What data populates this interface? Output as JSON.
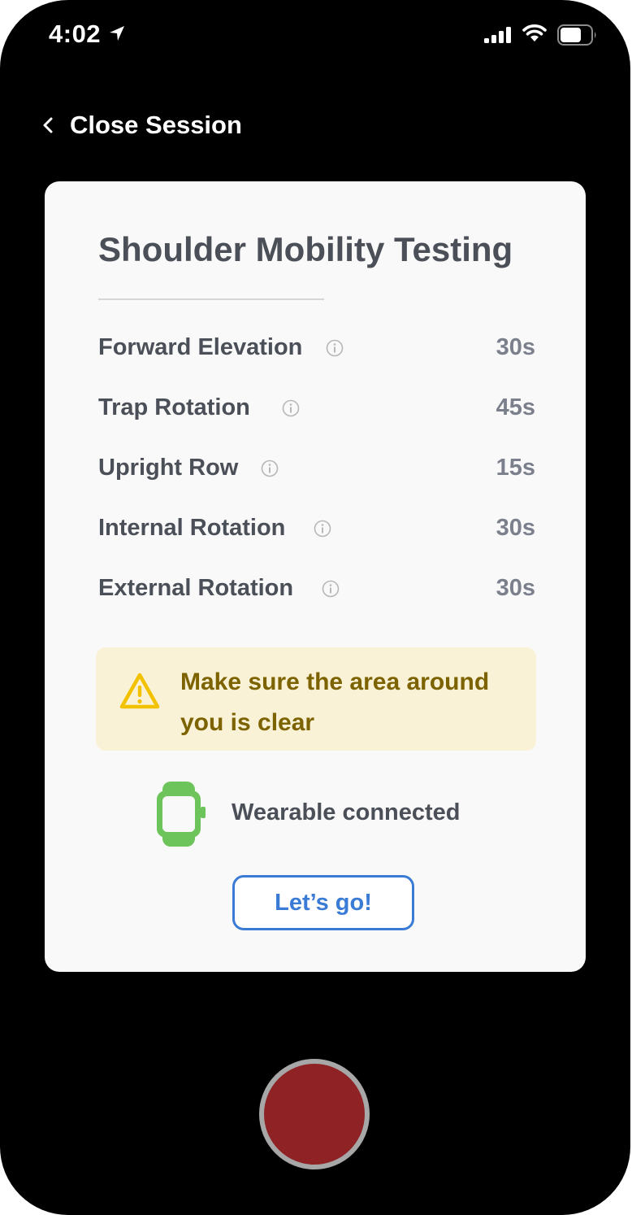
{
  "status_bar": {
    "time": "4:02",
    "icons": [
      "location-arrow-icon",
      "cellular-signal-icon",
      "wifi-icon",
      "battery-icon"
    ]
  },
  "nav": {
    "back_label": "Close Session",
    "back_icon": "chevron-left-icon"
  },
  "card": {
    "title": "Shoulder Mobility Testing",
    "tests": [
      {
        "name": "Forward Elevation",
        "duration": "30s"
      },
      {
        "name": "Trap Rotation",
        "duration": "45s"
      },
      {
        "name": "Upright Row",
        "duration": "15s"
      },
      {
        "name": "Internal Rotation",
        "duration": "30s"
      },
      {
        "name": "External Rotation",
        "duration": "30s"
      }
    ],
    "warning": {
      "icon": "warning-triangle-icon",
      "text": "Make sure the area around you is clear"
    },
    "wearable": {
      "icon": "smartwatch-icon",
      "status": "Wearable connected"
    },
    "go_button_label": "Let’s go!"
  },
  "record_button": {
    "icon": "record-icon"
  },
  "colors": {
    "background": "#000000",
    "card": "#f9f9f9",
    "accent_blue": "#3a7bd5",
    "warning_bg": "#faf2d6",
    "warning_text": "#7d6300",
    "warning_icon": "#f2c200",
    "connected_green": "#6cc45a",
    "record_red": "#8e2224"
  }
}
